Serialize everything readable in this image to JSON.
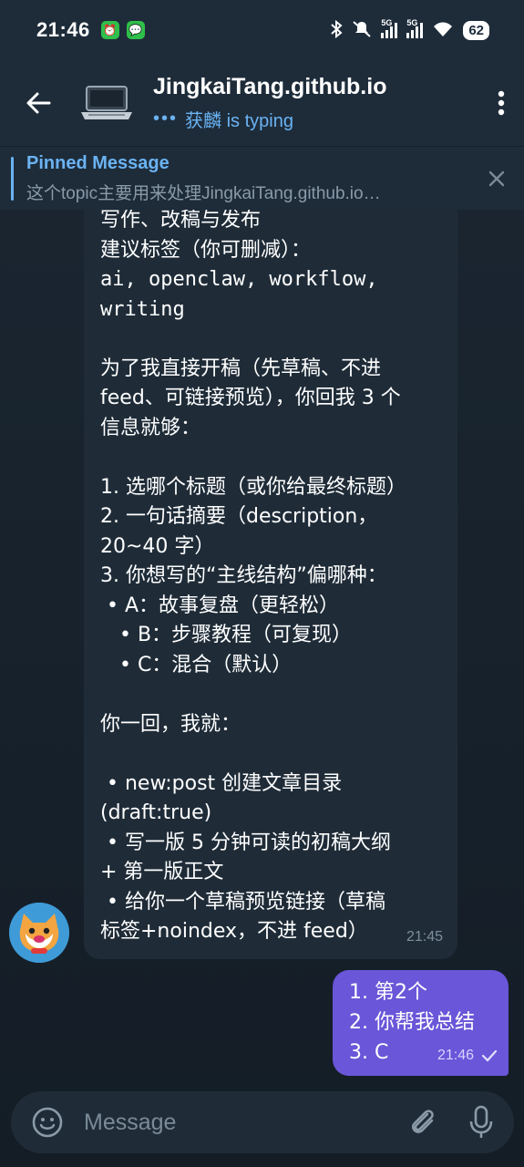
{
  "status_bar": {
    "time": "21:46",
    "network_1": "5G",
    "network_2": "5G",
    "battery": "62"
  },
  "header": {
    "title": "JingkaiTang.github.io",
    "typing_dots": "•••",
    "typing_text": "获麟 is typing"
  },
  "pinned": {
    "title": "Pinned Message",
    "body": "这个topic主要用来处理JingkaiTang.github.io…"
  },
  "messages": {
    "incoming": {
      "lines": [
        "写作、改稿与发布",
        "建议标签（你可删减）：",
        "ai, openclaw, workflow,",
        "writing",
        "",
        "为了我直接开稿（先草稿、不进",
        "feed、可链接预览），你回我 3 个",
        "信息就够：",
        "",
        "1. 选哪个标题（或你给最终标题）",
        "2. 一句话摘要（description，",
        "20~40 字）",
        "3. 你想写的“主线结构”偏哪种：",
        " • A：故事复盘（更轻松）",
        "   • B：步骤教程（可复现）",
        "   • C：混合（默认）",
        "",
        "你一回，我就：",
        "",
        " • new:post 创建文章目录",
        "(draft:true)",
        " • 写一版 5 分钟可读的初稿大纲",
        "+ 第一版正文",
        " • 给你一个草稿预览链接（草稿",
        "标签+noindex，不进 feed）"
      ],
      "time": "21:45"
    },
    "outgoing": {
      "lines": [
        "1. 第2个",
        "2. 你帮我总结",
        "3. C"
      ],
      "time": "21:46"
    }
  },
  "composer": {
    "placeholder": "Message"
  },
  "colors": {
    "header_bg": "#1e2c3a",
    "accent": "#6ab3f3",
    "incoming_bubble": "#1f2c38",
    "outgoing_bubble": "#6a56d8"
  },
  "icons": [
    "back-arrow-icon",
    "laptop-icon",
    "more-vert-icon",
    "close-icon",
    "emoji-icon",
    "attach-icon",
    "mic-icon",
    "check-icon",
    "bluetooth-icon",
    "mute-icon",
    "wifi-icon",
    "alarm-icon",
    "wechat-icon"
  ]
}
